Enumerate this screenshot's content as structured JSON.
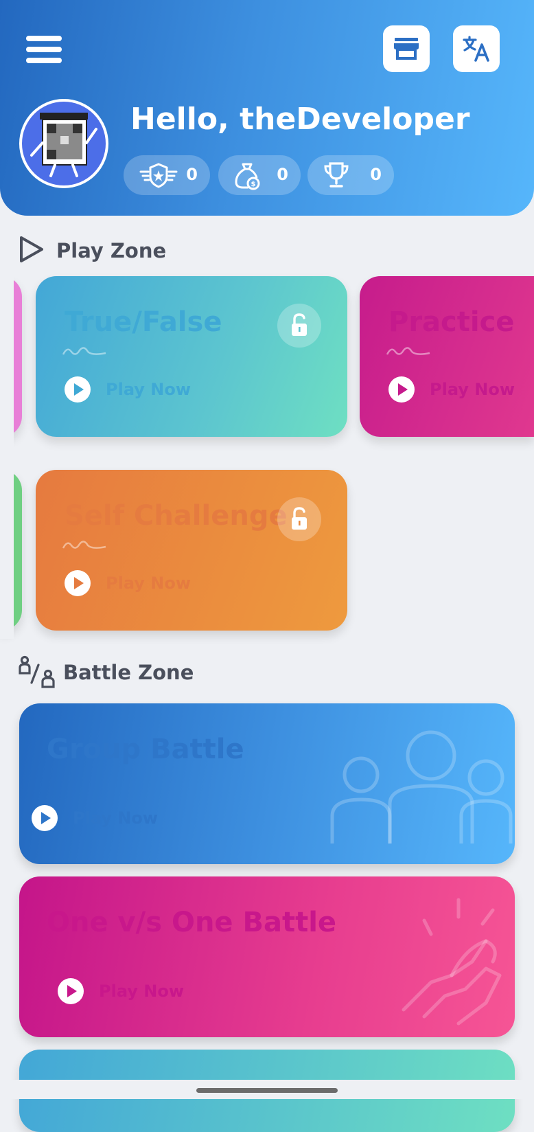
{
  "header": {
    "greeting": "Hello, theDeveloper",
    "stats": [
      {
        "icon": "rank-badge-icon",
        "value": "0"
      },
      {
        "icon": "coin-bag-icon",
        "value": "0"
      },
      {
        "icon": "trophy-icon",
        "value": "0"
      }
    ]
  },
  "play_zone": {
    "title": "Play Zone",
    "cards": [
      {
        "title": "True/False",
        "action": "Play Now",
        "locked": true
      },
      {
        "title": "Practice",
        "action": "Play Now"
      },
      {
        "title": "Self Challenge",
        "action": "Play Now",
        "locked": true
      }
    ]
  },
  "battle_zone": {
    "title": "Battle Zone",
    "cards": [
      {
        "title": "Group Battle",
        "action": "Play Now"
      },
      {
        "title": "One v/s One Battle",
        "action": "Play Now"
      }
    ]
  },
  "colors": {
    "header_start": "#2368bf",
    "header_end": "#56b6fb",
    "magenta": "#c61c8c",
    "orange": "#e67a3f",
    "teal": "#6edfc2"
  }
}
